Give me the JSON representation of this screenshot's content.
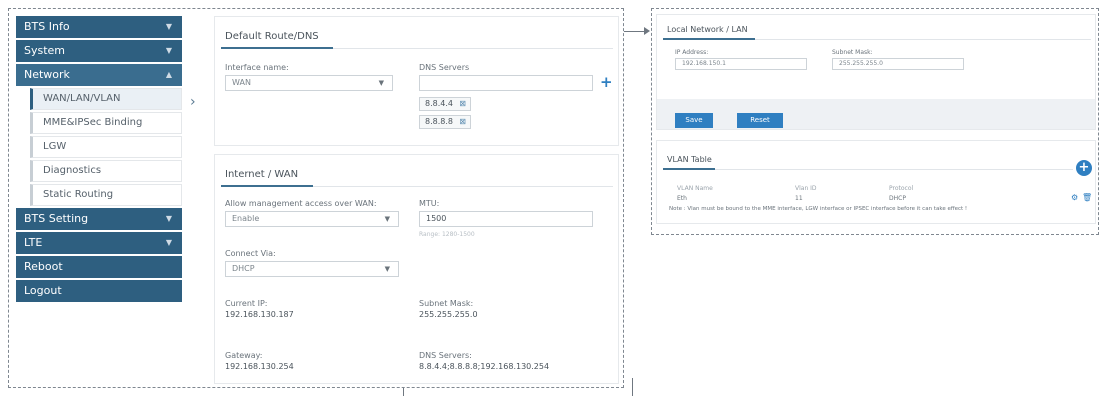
{
  "sidebar": {
    "menu": [
      {
        "label": "BTS Info"
      },
      {
        "label": "System"
      },
      {
        "label": "Network"
      }
    ],
    "network_sub": [
      {
        "label": "WAN/LAN/VLAN"
      },
      {
        "label": "MME&IPSec Binding"
      },
      {
        "label": "LGW"
      },
      {
        "label": "Diagnostics"
      },
      {
        "label": "Static Routing"
      }
    ],
    "menu_after": [
      {
        "label": "BTS Setting"
      },
      {
        "label": "LTE"
      },
      {
        "label": "Reboot"
      },
      {
        "label": "Logout"
      }
    ]
  },
  "default_route": {
    "title": "Default Route/DNS",
    "interface_label": "Interface name:",
    "interface_value": "WAN",
    "dns_label": "DNS Servers",
    "dns_entries": [
      "8.8.4.4",
      "8.8.8.8"
    ]
  },
  "internet_wan": {
    "title": "Internet / WAN",
    "allow_label": "Allow management access over WAN:",
    "allow_value": "Enable",
    "mtu_label": "MTU:",
    "mtu_value": "1500",
    "mtu_hint": "Range: 1280-1500",
    "connect_label": "Connect Via:",
    "connect_value": "DHCP",
    "current_ip_label": "Current IP:",
    "current_ip_value": "192.168.130.187",
    "subnet_label": "Subnet Mask:",
    "subnet_value": "255.255.255.0",
    "gateway_label": "Gateway:",
    "gateway_value": "192.168.130.254",
    "dns_label": "DNS Servers:",
    "dns_value": "8.8.4.4;8.8.8.8;192.168.130.254"
  },
  "lan": {
    "title": "Local Network / LAN",
    "ip_label": "IP Address:",
    "ip_value": "192.168.150.1",
    "mask_label": "Subnet Mask:",
    "mask_value": "255.255.255.0",
    "save_label": "Save",
    "reset_label": "Reset"
  },
  "vlan": {
    "title": "VLAN Table",
    "headers": [
      "VLAN Name",
      "Vlan ID",
      "Protocol"
    ],
    "row": [
      "Eth",
      "11",
      "DHCP"
    ],
    "note": "Note : Vlan must be bound to the MME interface, LGW interface or IPSEC interface before it can take effect !"
  },
  "colors": {
    "menu_bg": "#2e5f80",
    "accent": "#2f7fc1"
  }
}
